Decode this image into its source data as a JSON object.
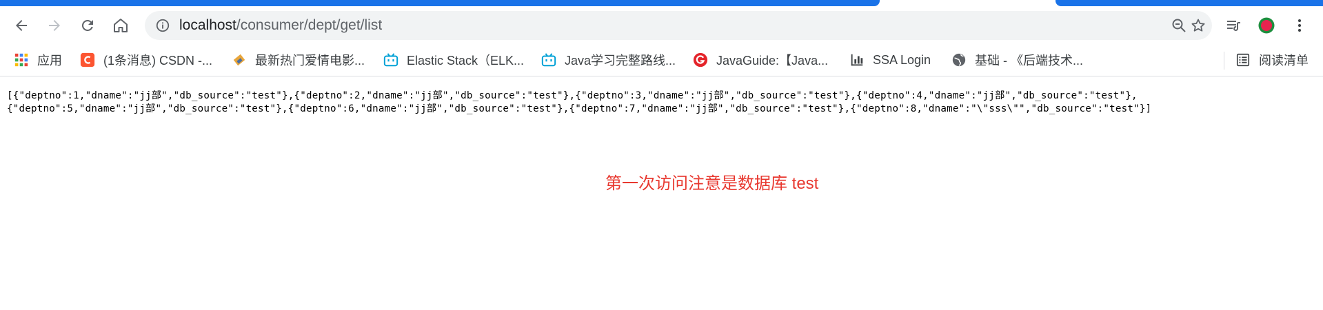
{
  "browser": {
    "accent_color": "#1a73e8",
    "nav": {
      "back": "back-arrow",
      "forward": "forward-arrow",
      "reload": "reload",
      "home": "home"
    },
    "address": {
      "host": "localhost",
      "path": "/consumer/dept/get/list"
    },
    "toolbar_icons": [
      "zoom-icon",
      "star-icon",
      "reading-list-icon",
      "profile-avatar",
      "menu-icon"
    ]
  },
  "bookmarks": {
    "apps": "应用",
    "items": [
      {
        "label": "(1条消息) CSDN -...",
        "icon": "csdn-icon",
        "color": "#fc5531"
      },
      {
        "label": "最新热门爱情电影...",
        "icon": "movie-icon",
        "color": "#e8a53a"
      },
      {
        "label": "Elastic Stack（ELK...",
        "icon": "bilibili-icon",
        "color": "#00a1d6"
      },
      {
        "label": "Java学习完整路线...",
        "icon": "bilibili-icon",
        "color": "#00a1d6"
      },
      {
        "label": "JavaGuide:【Java...",
        "icon": "javaguide-icon",
        "color": "#e4252b"
      },
      {
        "label": "SSA Login",
        "icon": "chart-icon",
        "color": "#3c4043"
      },
      {
        "label": "基础 - 《后端技术...",
        "icon": "globe-icon",
        "color": "#5f6368"
      }
    ],
    "reading_list": "阅读清单"
  },
  "page": {
    "json_line_1": "[{\"deptno\":1,\"dname\":\"jj部\",\"db_source\":\"test\"},{\"deptno\":2,\"dname\":\"jj部\",\"db_source\":\"test\"},{\"deptno\":3,\"dname\":\"jj部\",\"db_source\":\"test\"},{\"deptno\":4,\"dname\":\"jj部\",\"db_source\":\"test\"},",
    "json_line_2": "{\"deptno\":5,\"dname\":\"jj部\",\"db_source\":\"test\"},{\"deptno\":6,\"dname\":\"jj部\",\"db_source\":\"test\"},{\"deptno\":7,\"dname\":\"jj部\",\"db_source\":\"test\"},{\"deptno\":8,\"dname\":\"\\\"sss\\\"\",\"db_source\":\"test\"}]",
    "annotation": "第一次访问注意是数据库 test",
    "annotation_color": "#e8382f"
  }
}
